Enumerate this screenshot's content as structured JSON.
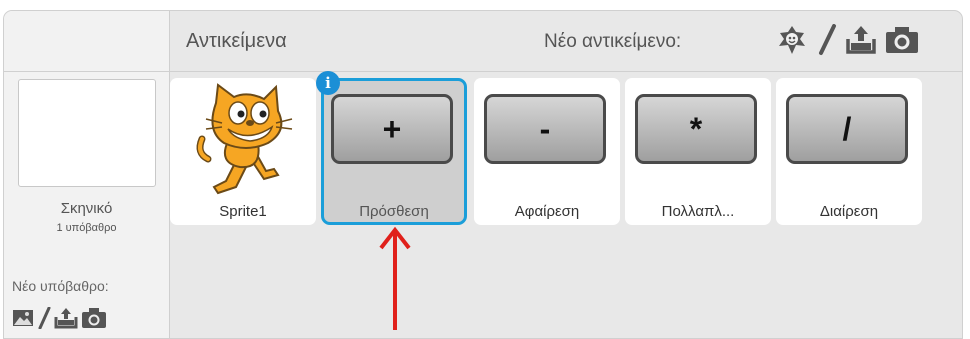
{
  "stage": {
    "label": "Σκηνικό",
    "backdrops_count": "1 υπόβαθρο",
    "new_backdrop_label": "Νέο υπόβαθρο:",
    "tools": [
      "image-icon",
      "paintbrush-icon",
      "upload-icon",
      "camera-icon"
    ]
  },
  "sprites_pane": {
    "title": "Αντικείμενα",
    "new_sprite_label": "Νέο αντικείμενο:",
    "tools": [
      "sprite-library-icon",
      "paintbrush-icon",
      "upload-icon",
      "camera-icon"
    ]
  },
  "sprites": [
    {
      "name": "Sprite1",
      "kind": "cat"
    },
    {
      "name": "Πρόσθεση",
      "symbol": "+",
      "selected": true
    },
    {
      "name": "Αφαίρεση",
      "symbol": "-"
    },
    {
      "name": "Πολλαπλ...",
      "symbol": "*"
    },
    {
      "name": "Διαίρεση",
      "symbol": "/"
    }
  ],
  "colors": {
    "selection": "#1b9ed9",
    "annotation_arrow": "#e0201b"
  }
}
